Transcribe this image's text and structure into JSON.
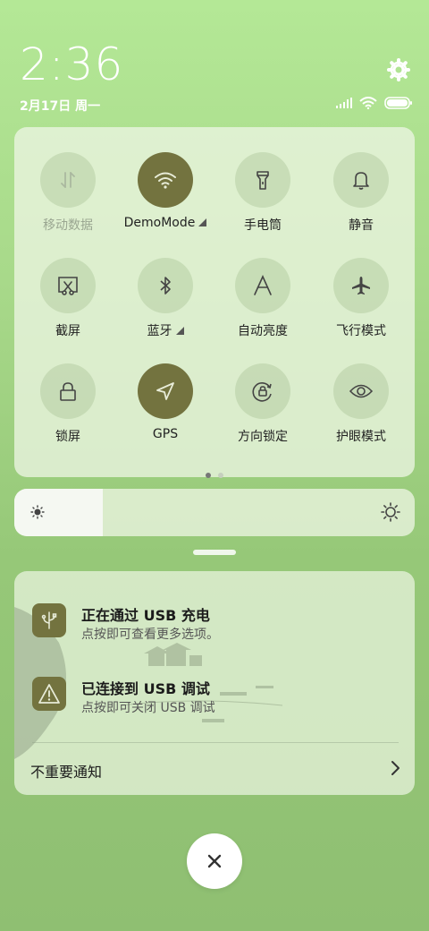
{
  "header": {
    "time": "2:36",
    "date": "2月17日 周一"
  },
  "quick_settings": {
    "tiles": [
      {
        "label": "移动数据",
        "icon": "mobile-data-icon",
        "active": false,
        "disabled": true
      },
      {
        "label": "DemoMode",
        "icon": "wifi-icon",
        "active": true,
        "expandable": true
      },
      {
        "label": "手电筒",
        "icon": "flashlight-icon",
        "active": false
      },
      {
        "label": "静音",
        "icon": "bell-icon",
        "active": false
      },
      {
        "label": "截屏",
        "icon": "screenshot-icon",
        "active": false
      },
      {
        "label": "蓝牙",
        "icon": "bluetooth-icon",
        "active": false,
        "expandable": true
      },
      {
        "label": "自动亮度",
        "icon": "auto-brightness-icon",
        "active": false
      },
      {
        "label": "飞行模式",
        "icon": "airplane-icon",
        "active": false
      },
      {
        "label": "锁屏",
        "icon": "lock-icon",
        "active": false
      },
      {
        "label": "GPS",
        "icon": "location-arrow-icon",
        "active": true
      },
      {
        "label": "方向锁定",
        "icon": "rotation-lock-icon",
        "active": false
      },
      {
        "label": "护眼模式",
        "icon": "eye-icon",
        "active": false
      }
    ],
    "page_count": 2,
    "current_page": 1
  },
  "brightness": {
    "level": 0.22
  },
  "notifications": [
    {
      "title": "正在通过 USB 充电",
      "body": "点按即可查看更多选项。",
      "icon": "usb-charging-icon"
    },
    {
      "title": "已连接到 USB 调试",
      "body": "点按即可关闭 USB 调试",
      "icon": "warning-icon"
    }
  ],
  "unimportant_label": "不重要通知",
  "colors": {
    "accent": "#73733f",
    "background": "#a8d98a"
  }
}
